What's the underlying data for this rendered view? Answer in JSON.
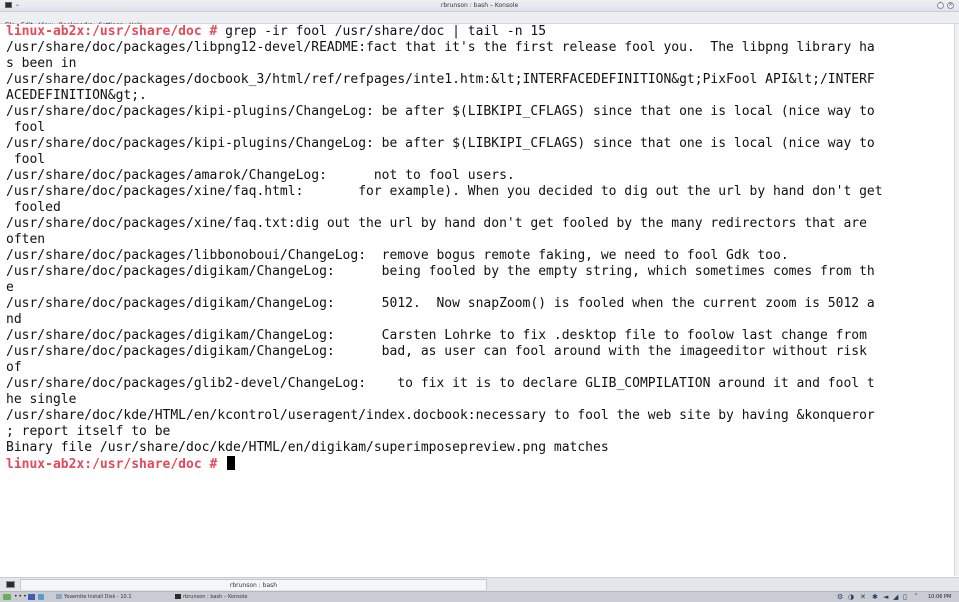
{
  "window": {
    "title": "rbrunson : bash – Konsole"
  },
  "menubar": {
    "items": [
      "File",
      "Edit",
      "View",
      "Bookmarks",
      "Settings",
      "Help"
    ]
  },
  "terminal": {
    "prompt": "linux-ab2x:/usr/share/doc #",
    "command": " grep -ir fool /usr/share/doc | tail -n 15",
    "output": [
      "/usr/share/doc/packages/libpng12-devel/README:fact that it's the first release fool you.  The libpng library ha",
      "s been in",
      "/usr/share/doc/packages/docbook_3/html/ref/refpages/inte1.htm:&lt;INTERFACEDEFINITION&gt;PixFool API&lt;/INTERF",
      "ACEDEFINITION&gt;.",
      "/usr/share/doc/packages/kipi-plugins/ChangeLog: be after $(LIBKIPI_CFLAGS) since that one is local (nice way to",
      " fool",
      "/usr/share/doc/packages/kipi-plugins/ChangeLog: be after $(LIBKIPI_CFLAGS) since that one is local (nice way to",
      " fool",
      "/usr/share/doc/packages/amarok/ChangeLog:      not to fool users.",
      "/usr/share/doc/packages/xine/faq.html:       for example). When you decided to dig out the url by hand don't get",
      " fooled",
      "/usr/share/doc/packages/xine/faq.txt:dig out the url by hand don't get fooled by the many redirectors that are",
      "often",
      "/usr/share/doc/packages/libbonoboui/ChangeLog:  remove bogus remote faking, we need to fool Gdk too.",
      "/usr/share/doc/packages/digikam/ChangeLog:      being fooled by the empty string, which sometimes comes from th",
      "e",
      "/usr/share/doc/packages/digikam/ChangeLog:      5012.  Now snapZoom() is fooled when the current zoom is 5012 a",
      "nd",
      "/usr/share/doc/packages/digikam/ChangeLog:      Carsten Lohrke to fix .desktop file to foolow last change from",
      "/usr/share/doc/packages/digikam/ChangeLog:      bad, as user can fool around with the imageeditor without risk",
      "of",
      "/usr/share/doc/packages/glib2-devel/ChangeLog:    to fix it is to declare GLIB_COMPILATION around it and fool t",
      "he single",
      "/usr/share/doc/kde/HTML/en/kcontrol/useragent/index.docbook:necessary to fool the web site by having &konqueror",
      "; report itself to be",
      "Binary file /usr/share/doc/kde/HTML/en/digikam/superimposepreview.png matches"
    ],
    "final_prompt": "linux-ab2x:/usr/share/doc #"
  },
  "tabstrip": {
    "tab_label": "rbrunson : bash"
  },
  "taskbar": {
    "tasks": [
      {
        "label": "Yosemite Install Disk - 10.1",
        "icon": "disk-icon"
      },
      {
        "label": "rbrunson : bash – Konsole",
        "icon": "konsole-icon"
      }
    ],
    "clock": "10:06 PM"
  }
}
